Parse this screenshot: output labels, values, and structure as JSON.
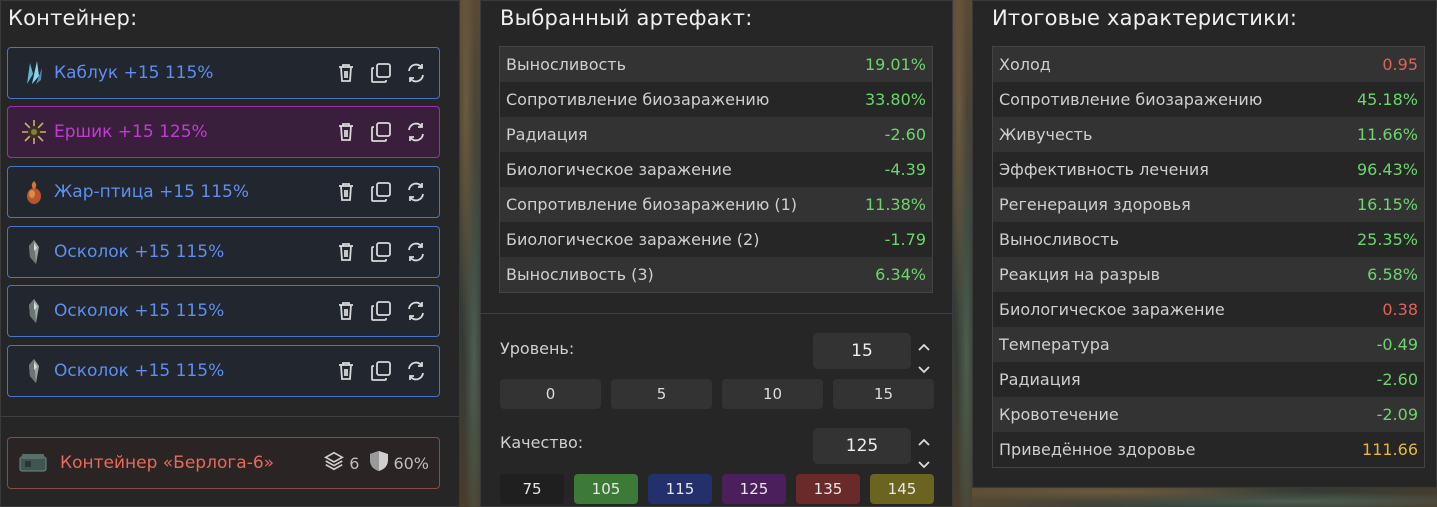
{
  "container_panel": {
    "title": "Контейнер:",
    "items": [
      {
        "label": "Каблук +15 115%",
        "icon": "crystal-icon",
        "style": "blue"
      },
      {
        "label": "Ершик +15 125%",
        "icon": "urchin-icon",
        "style": "purple"
      },
      {
        "label": "Жар-птица +15 115%",
        "icon": "firebird-icon",
        "style": "blue"
      },
      {
        "label": "Осколок +15 115%",
        "icon": "shard-icon",
        "style": "blue"
      },
      {
        "label": "Осколок +15 115%",
        "icon": "shard-icon",
        "style": "blue"
      },
      {
        "label": "Осколок +15 115%",
        "icon": "shard-icon",
        "style": "blue"
      }
    ],
    "container": {
      "label": "Контейнер «Берлога-6»",
      "slots": "6",
      "protection": "60%"
    }
  },
  "selected_artifact": {
    "title": "Выбранный артефакт:",
    "stats": [
      {
        "name": "Выносливость",
        "value": "19.01%",
        "tone": "green"
      },
      {
        "name": "Сопротивление биозаражению",
        "value": "33.80%",
        "tone": "green"
      },
      {
        "name": "Радиация",
        "value": "-2.60",
        "tone": "green"
      },
      {
        "name": "Биологическое заражение",
        "value": "-4.39",
        "tone": "green"
      },
      {
        "name": "Сопротивление биозаражению (1)",
        "value": "11.38%",
        "tone": "green"
      },
      {
        "name": "Биологическое заражение (2)",
        "value": "-1.79",
        "tone": "green"
      },
      {
        "name": "Выносливость (3)",
        "value": "6.34%",
        "tone": "green"
      }
    ],
    "level": {
      "label": "Уровень:",
      "value": "15",
      "presets": [
        "0",
        "5",
        "10",
        "15"
      ]
    },
    "quality": {
      "label": "Качество:",
      "value": "125",
      "presets": [
        {
          "label": "75",
          "color": "#1f1f1f"
        },
        {
          "label": "105",
          "color": "#3d7a37"
        },
        {
          "label": "115",
          "color": "#23306b"
        },
        {
          "label": "125",
          "color": "#4b1f5c"
        },
        {
          "label": "135",
          "color": "#6b2a2a"
        },
        {
          "label": "145",
          "color": "#6b6320"
        }
      ]
    }
  },
  "total_stats": {
    "title": "Итоговые характеристики:",
    "stats": [
      {
        "name": "Холод",
        "value": "0.95",
        "tone": "red"
      },
      {
        "name": "Сопротивление биозаражению",
        "value": "45.18%",
        "tone": "green"
      },
      {
        "name": "Живучесть",
        "value": "11.66%",
        "tone": "green"
      },
      {
        "name": "Эффективность лечения",
        "value": "96.43%",
        "tone": "green"
      },
      {
        "name": "Регенерация здоровья",
        "value": "16.15%",
        "tone": "green"
      },
      {
        "name": "Выносливость",
        "value": "25.35%",
        "tone": "green"
      },
      {
        "name": "Реакция на разрыв",
        "value": "6.58%",
        "tone": "green"
      },
      {
        "name": "Биологическое заражение",
        "value": "0.38",
        "tone": "red"
      },
      {
        "name": "Температура",
        "value": "-0.49",
        "tone": "green"
      },
      {
        "name": "Радиация",
        "value": "-2.60",
        "tone": "green"
      },
      {
        "name": "Кровотечение",
        "value": "-2.09",
        "tone": "green"
      },
      {
        "name": "Приведённое здоровье",
        "value": "111.66",
        "tone": "yellow"
      }
    ]
  }
}
